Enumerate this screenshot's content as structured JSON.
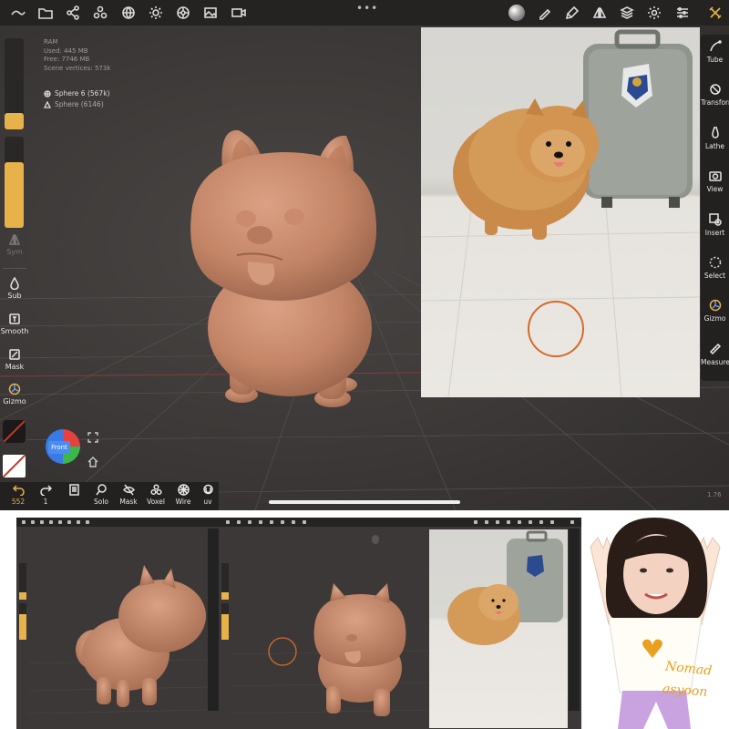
{
  "info": {
    "ram": "RAM",
    "used": "Used: 445 MB",
    "free": "Free: 7746 MB",
    "scene_vertices": "Scene vertices: 573k"
  },
  "objects": [
    {
      "name": "Sphere 6 (567k)",
      "selected": true
    },
    {
      "name": "Sphere (6146)",
      "selected": false
    }
  ],
  "left_tools": {
    "sym": "Sym",
    "sub": "Sub",
    "smooth": "Smooth",
    "mask": "Mask",
    "gizmo": "Gizmo"
  },
  "right_tools": [
    "Tube",
    "Transform",
    "Lathe",
    "View",
    "Insert",
    "Select",
    "Gizmo",
    "Measure"
  ],
  "bottom_tools": {
    "undo_count": "552",
    "redo_count": "1",
    "solo": "Solo",
    "mask": "Mask",
    "voxel": "Voxel",
    "wire": "Wire",
    "uv": "uv"
  },
  "view_cube": {
    "label": "Front"
  },
  "version": "1.76",
  "signature": {
    "line1": "Nomad",
    "line2": "asyoon"
  },
  "colors": {
    "accent": "#e7b24a",
    "brush": "#d46a2a",
    "clay": "#c98a6a"
  }
}
